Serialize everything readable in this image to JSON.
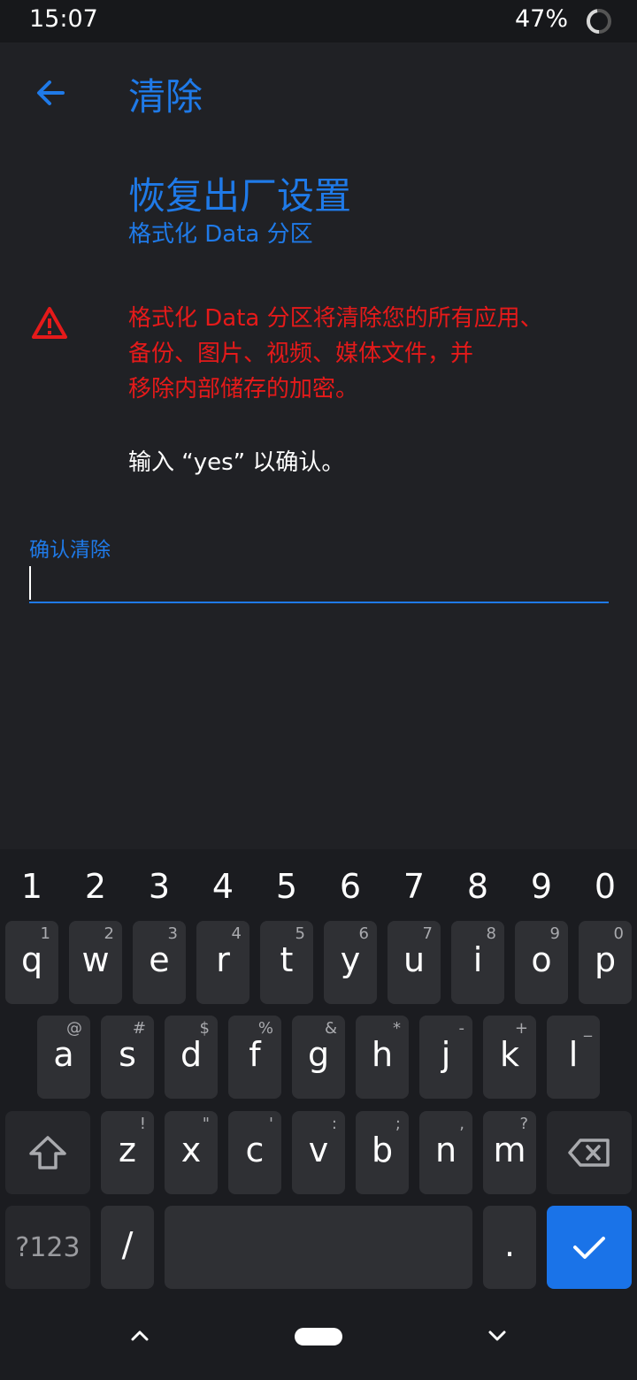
{
  "status": {
    "time": "15:07",
    "battery": "47%"
  },
  "header": {
    "title": "清除"
  },
  "page": {
    "title": "恢复出厂设置",
    "subtitle": "格式化 Data 分区",
    "warning_lines": [
      "格式化 Data 分区将清除您的所有应用、",
      "备份、图片、视频、媒体文件，并",
      "移除内部储存的加密。"
    ],
    "confirm_hint": "输入 “yes” 以确认。"
  },
  "input": {
    "label": "确认清除",
    "value": ""
  },
  "colors": {
    "accent": "#1f7ae8",
    "warning": "#e51a1a",
    "background": "#202125"
  },
  "keyboard": {
    "numbers": [
      "1",
      "2",
      "3",
      "4",
      "5",
      "6",
      "7",
      "8",
      "9",
      "0"
    ],
    "row1": [
      {
        "k": "q",
        "h": "1"
      },
      {
        "k": "w",
        "h": "2"
      },
      {
        "k": "e",
        "h": "3"
      },
      {
        "k": "r",
        "h": "4"
      },
      {
        "k": "t",
        "h": "5"
      },
      {
        "k": "y",
        "h": "6"
      },
      {
        "k": "u",
        "h": "7"
      },
      {
        "k": "i",
        "h": "8"
      },
      {
        "k": "o",
        "h": "9"
      },
      {
        "k": "p",
        "h": "0"
      }
    ],
    "row2": [
      {
        "k": "a",
        "h": "@"
      },
      {
        "k": "s",
        "h": "#"
      },
      {
        "k": "d",
        "h": "$"
      },
      {
        "k": "f",
        "h": "%"
      },
      {
        "k": "g",
        "h": "&"
      },
      {
        "k": "h",
        "h": "*"
      },
      {
        "k": "j",
        "h": "-"
      },
      {
        "k": "k",
        "h": "+"
      },
      {
        "k": "l",
        "h": "_"
      }
    ],
    "row3": [
      {
        "k": "z",
        "h": "!"
      },
      {
        "k": "x",
        "h": "\""
      },
      {
        "k": "c",
        "h": "'"
      },
      {
        "k": "v",
        "h": ":"
      },
      {
        "k": "b",
        "h": ";"
      },
      {
        "k": "n",
        "h": ","
      },
      {
        "k": "m",
        "h": "?"
      }
    ],
    "symbols_label": "?123",
    "slash": "/",
    "period": ".",
    "icons": {
      "shift": "shift-icon",
      "backspace": "backspace-icon",
      "enter": "checkmark-icon"
    }
  }
}
